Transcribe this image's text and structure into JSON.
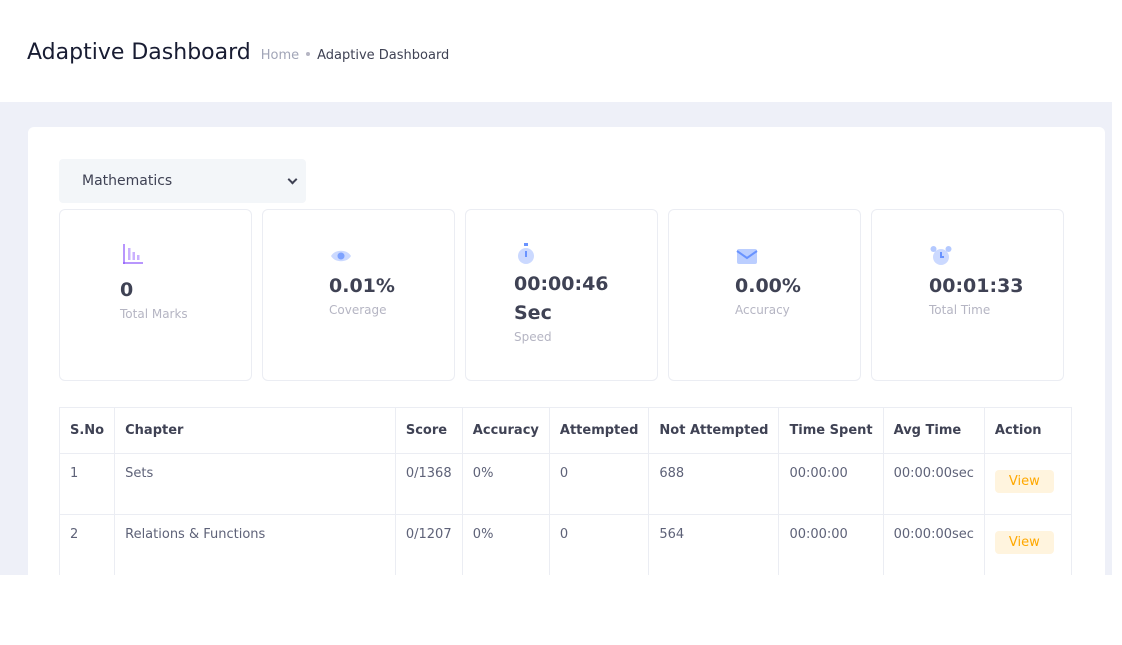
{
  "header": {
    "title": "Adaptive Dashboard",
    "breadcrumb": {
      "home": "Home",
      "current": "Adaptive Dashboard"
    }
  },
  "subject_select": {
    "selected": "Mathematics"
  },
  "stats": [
    {
      "value": "0",
      "label": "Total Marks",
      "icon": "bar-chart-icon",
      "color": "#8950fc"
    },
    {
      "value": "0.01%",
      "label": "Coverage",
      "icon": "eye-icon",
      "color": "#6993ff"
    },
    {
      "value": "00:00:46 Sec",
      "label": "Speed",
      "icon": "stopwatch-icon",
      "color": "#6993ff"
    },
    {
      "value": "0.00%",
      "label": "Accuracy",
      "icon": "mail-icon",
      "color": "#6993ff"
    },
    {
      "value": "00:01:33",
      "label": "Total Time",
      "icon": "alarm-clock-icon",
      "color": "#6993ff"
    }
  ],
  "table": {
    "columns": [
      "S.No",
      "Chapter",
      "Score",
      "Accuracy",
      "Attempted",
      "Not Attempted",
      "Time Spent",
      "Avg Time",
      "Action"
    ],
    "rows": [
      {
        "sno": "1",
        "chapter": "Sets",
        "score": "0/1368",
        "accuracy": "0%",
        "attempted": "0",
        "not_attempted": "688",
        "time_spent": "00:00:00",
        "avg_time": "00:00:00sec",
        "action": "View"
      },
      {
        "sno": "2",
        "chapter": "Relations & Functions",
        "score": "0/1207",
        "accuracy": "0%",
        "attempted": "0",
        "not_attempted": "564",
        "time_spent": "00:00:00",
        "avg_time": "00:00:00sec",
        "action": "View"
      }
    ]
  },
  "colors": {
    "accent": "#6993ff",
    "background": "#eef0f8",
    "warning": "#ffa800",
    "warning_light": "#fff4de"
  }
}
